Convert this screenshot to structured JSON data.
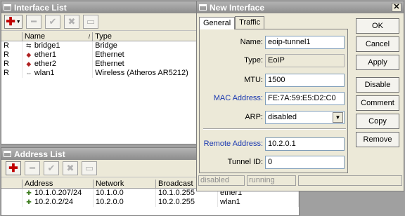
{
  "interface_list": {
    "title": "Interface List",
    "columns": [
      "Name",
      "Type"
    ],
    "rows": [
      {
        "flag": "R",
        "icon": "bridge-icon",
        "name": "bridge1",
        "type": "Bridge"
      },
      {
        "flag": "R",
        "icon": "ethernet-icon",
        "name": "ether1",
        "type": "Ethernet"
      },
      {
        "flag": "R",
        "icon": "ethernet-icon",
        "name": "ether2",
        "type": "Ethernet"
      },
      {
        "flag": "R",
        "icon": "wireless-icon",
        "name": "wlan1",
        "type": "Wireless (Atheros AR5212)"
      }
    ]
  },
  "address_list": {
    "title": "Address List",
    "columns": [
      "Address",
      "Network",
      "Broadcast",
      ""
    ],
    "rows": [
      {
        "address": "10.1.0.207/24",
        "network": "10.1.0.0",
        "broadcast": "10.1.0.255",
        "interface": "ether1"
      },
      {
        "address": "10.2.0.2/24",
        "network": "10.2.0.0",
        "broadcast": "10.2.0.255",
        "interface": "wlan1"
      }
    ]
  },
  "new_interface": {
    "title": "New Interface",
    "tabs": [
      "General",
      "Traffic"
    ],
    "fields": {
      "name_label": "Name:",
      "name_value": "eoip-tunnel1",
      "type_label": "Type:",
      "type_value": "EoIP",
      "mtu_label": "MTU:",
      "mtu_value": "1500",
      "mac_label": "MAC Address:",
      "mac_value": "FE:7A:59:E5:D2:C0",
      "arp_label": "ARP:",
      "arp_value": "disabled",
      "remote_label": "Remote Address:",
      "remote_value": "10.2.0.1",
      "tunnel_label": "Tunnel ID:",
      "tunnel_value": "0"
    },
    "buttons": [
      "OK",
      "Cancel",
      "Apply",
      "Disable",
      "Comment",
      "Copy",
      "Remove"
    ],
    "status": [
      "disabled",
      "running"
    ]
  },
  "colors": {
    "field_label_blue": "#1a38b0",
    "add_red": "#c00000"
  }
}
